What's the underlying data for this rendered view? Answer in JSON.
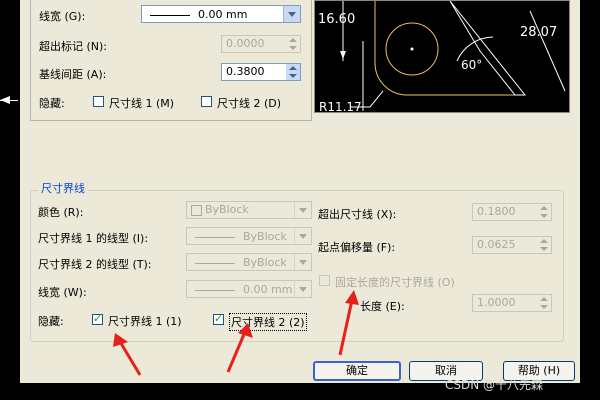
{
  "top_section": {
    "linewidth_label": "线宽 (G):",
    "linewidth_value": "0.00 mm",
    "extend_beyond_label": "超出标记 (N):",
    "extend_beyond_value": "0.0000",
    "baseline_spacing_label": "基线间距 (A):",
    "baseline_spacing_value": "0.3800",
    "suppress_label": "隐藏:",
    "dim1_label": "尺寸线 1 (M)",
    "dim2_label": "尺寸线 2 (D)"
  },
  "preview": {
    "labels": [
      "16.60",
      "28.07",
      "60°",
      "R11.17"
    ]
  },
  "extension_lines": {
    "title": "尺寸界线",
    "color_label": "颜色 (R):",
    "color_value": "ByBlock",
    "ext1_linetype_label": "尺寸界线 1 的线型 (I):",
    "ext1_linetype_value": "ByBlock",
    "ext2_linetype_label": "尺寸界线 2 的线型 (T):",
    "ext2_linetype_value": "ByBlock",
    "linewidth_label": "线宽 (W):",
    "linewidth_value": "0.00 mm",
    "suppress_label": "隐藏:",
    "ext1_label": "尺寸界线 1 (1)",
    "ext2_label": "尺寸界线 2 (2)",
    "extend_beyond_label": "超出尺寸线 (X):",
    "extend_beyond_value": "0.1800",
    "offset_label": "起点偏移量 (F):",
    "offset_value": "0.0625",
    "fixed_length_label": "固定长度的尺寸界线 (O)",
    "length_label": "长度 (E):",
    "length_value": "1.0000"
  },
  "buttons": {
    "ok": "确定",
    "cancel": "取消",
    "help": "帮助 (H)"
  },
  "watermark": "CSDN @十八先森",
  "colors": {
    "annotation_arrow": "#e8201c",
    "group_title": "#0046d5"
  }
}
